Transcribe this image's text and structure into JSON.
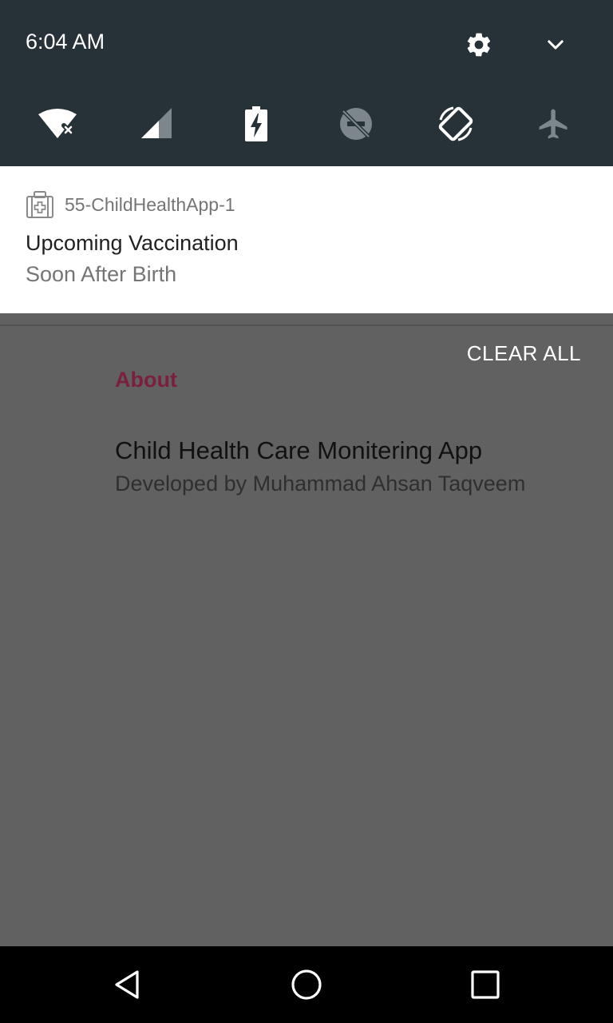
{
  "status": {
    "time": "6:04 AM"
  },
  "quick_settings": {
    "settings_icon": "gear-icon",
    "expand_icon": "chevron-down-icon",
    "tiles": [
      {
        "name": "wifi-off-icon",
        "state": "disconnected"
      },
      {
        "name": "cellular-signal-icon",
        "state": "no data"
      },
      {
        "name": "battery-charging-icon",
        "state": "charging"
      },
      {
        "name": "do-not-disturb-off-icon",
        "state": "off"
      },
      {
        "name": "auto-rotate-icon",
        "state": "on"
      },
      {
        "name": "airplane-mode-icon",
        "state": "off"
      }
    ]
  },
  "notification": {
    "app_icon": "first-aid-kit-icon",
    "app_name": "55-ChildHealthApp-1",
    "title": "Upcoming Vaccination",
    "text": "Soon After Birth"
  },
  "actions": {
    "clear_all": "CLEAR ALL"
  },
  "background_app": {
    "section_header": "About",
    "title": "Child Health Care Monitering App",
    "subtitle": "Developed by Muhammad Ahsan Taqveem"
  },
  "navbar": {
    "back_icon": "back-triangle-icon",
    "home_icon": "home-circle-icon",
    "recents_icon": "recents-square-icon"
  },
  "colors": {
    "shade_bg": "#263238",
    "scrim": "#616161",
    "accent": "#7b1f3f"
  }
}
